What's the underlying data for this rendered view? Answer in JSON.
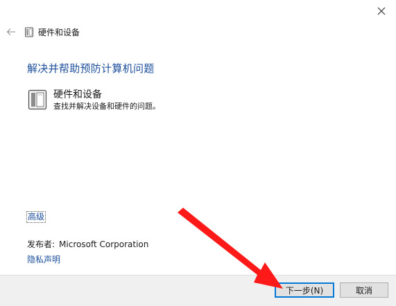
{
  "window": {
    "title": "硬件和设备",
    "close_icon": "close-icon",
    "back_icon": "back-arrow-icon"
  },
  "main": {
    "heading": "解决并帮助预防计算机问题",
    "item": {
      "title": "硬件和设备",
      "description": "查找并解决设备和硬件的问题。",
      "icon": "hardware-device-icon"
    },
    "advanced_link": "高级",
    "publisher_label": "发布者:",
    "publisher_value": "Microsoft Corporation",
    "privacy_link": "隐私声明"
  },
  "footer": {
    "next_button": "下一步(N)",
    "cancel_button": "取消"
  },
  "colors": {
    "link": "#1d4f9c",
    "annotation_arrow": "#ff1a1a",
    "default_button_border": "#0078d7"
  }
}
